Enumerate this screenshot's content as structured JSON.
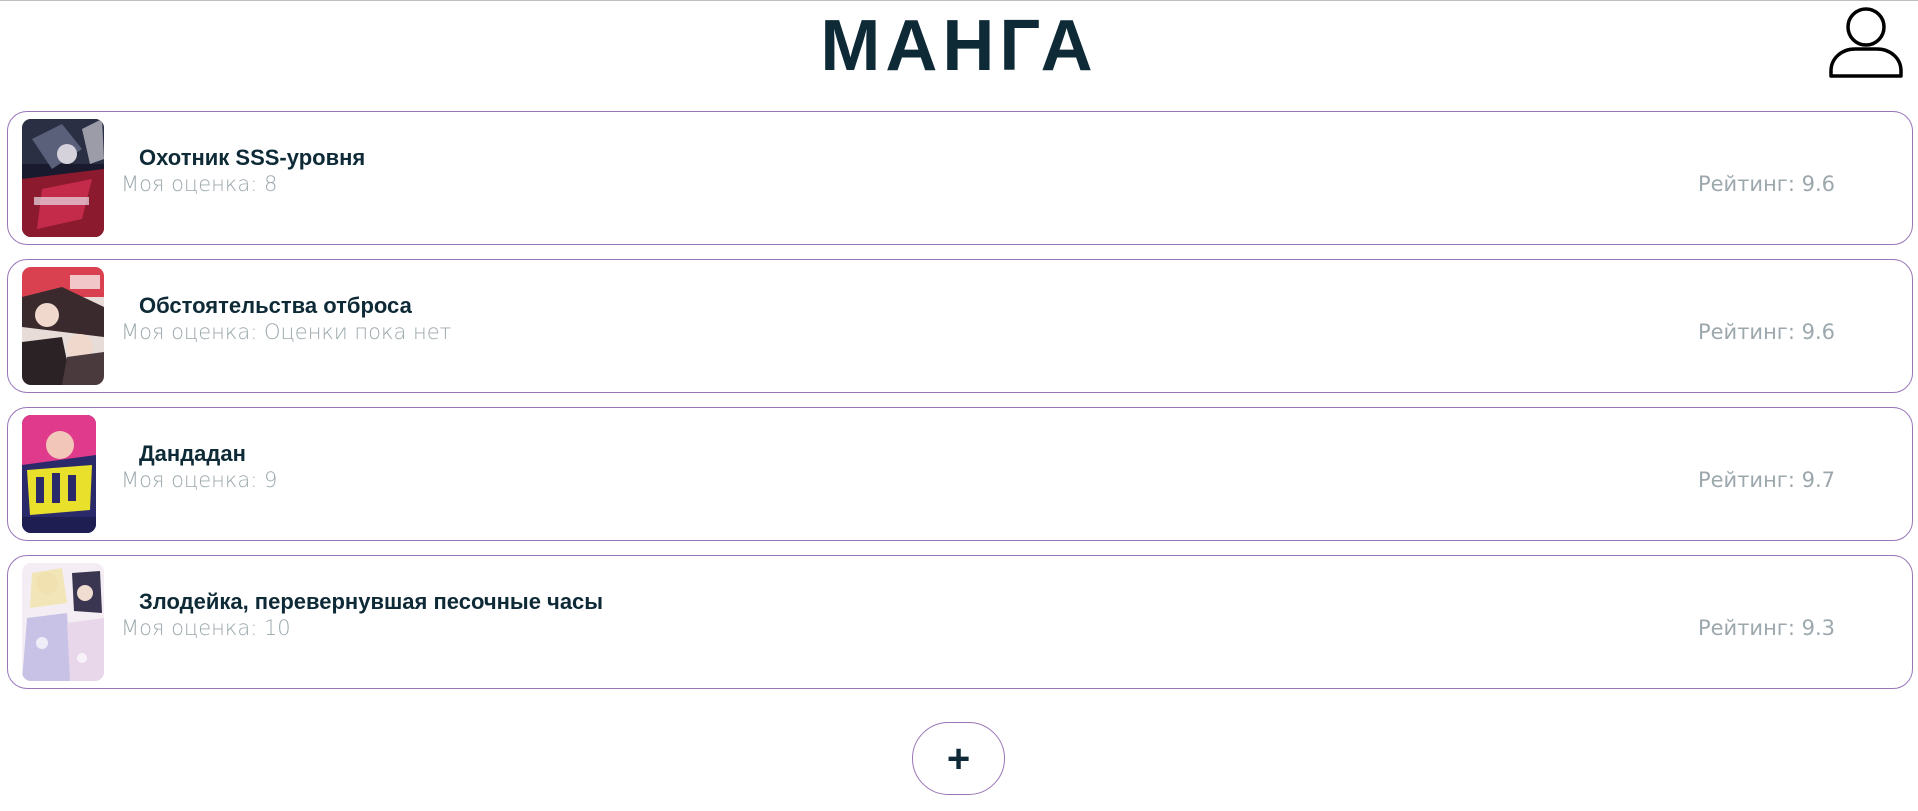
{
  "header": {
    "title": "МАНГА",
    "profile_icon": "user-icon"
  },
  "manga": [
    {
      "title": "Охотник SSS-уровня",
      "my_rating_label": "Моя оценка: 8",
      "rating_label": "Рейтинг: 9.6"
    },
    {
      "title": "Обстоятельства отброса",
      "my_rating_label": "Моя оценка: Оценки пока нет",
      "rating_label": "Рейтинг: 9.6"
    },
    {
      "title": "Дандадан",
      "my_rating_label": "Моя оценка: 9",
      "rating_label": "Рейтинг: 9.7"
    },
    {
      "title": "Злодейка, перевернувшая песочные часы",
      "my_rating_label": "Моя оценка: 10",
      "rating_label": "Рейтинг: 9.3"
    }
  ],
  "add_button": {
    "label": "+"
  },
  "colors": {
    "title": "#0e2a36",
    "card_border": "#9a76b6",
    "muted_text": "#9ca8ad"
  }
}
